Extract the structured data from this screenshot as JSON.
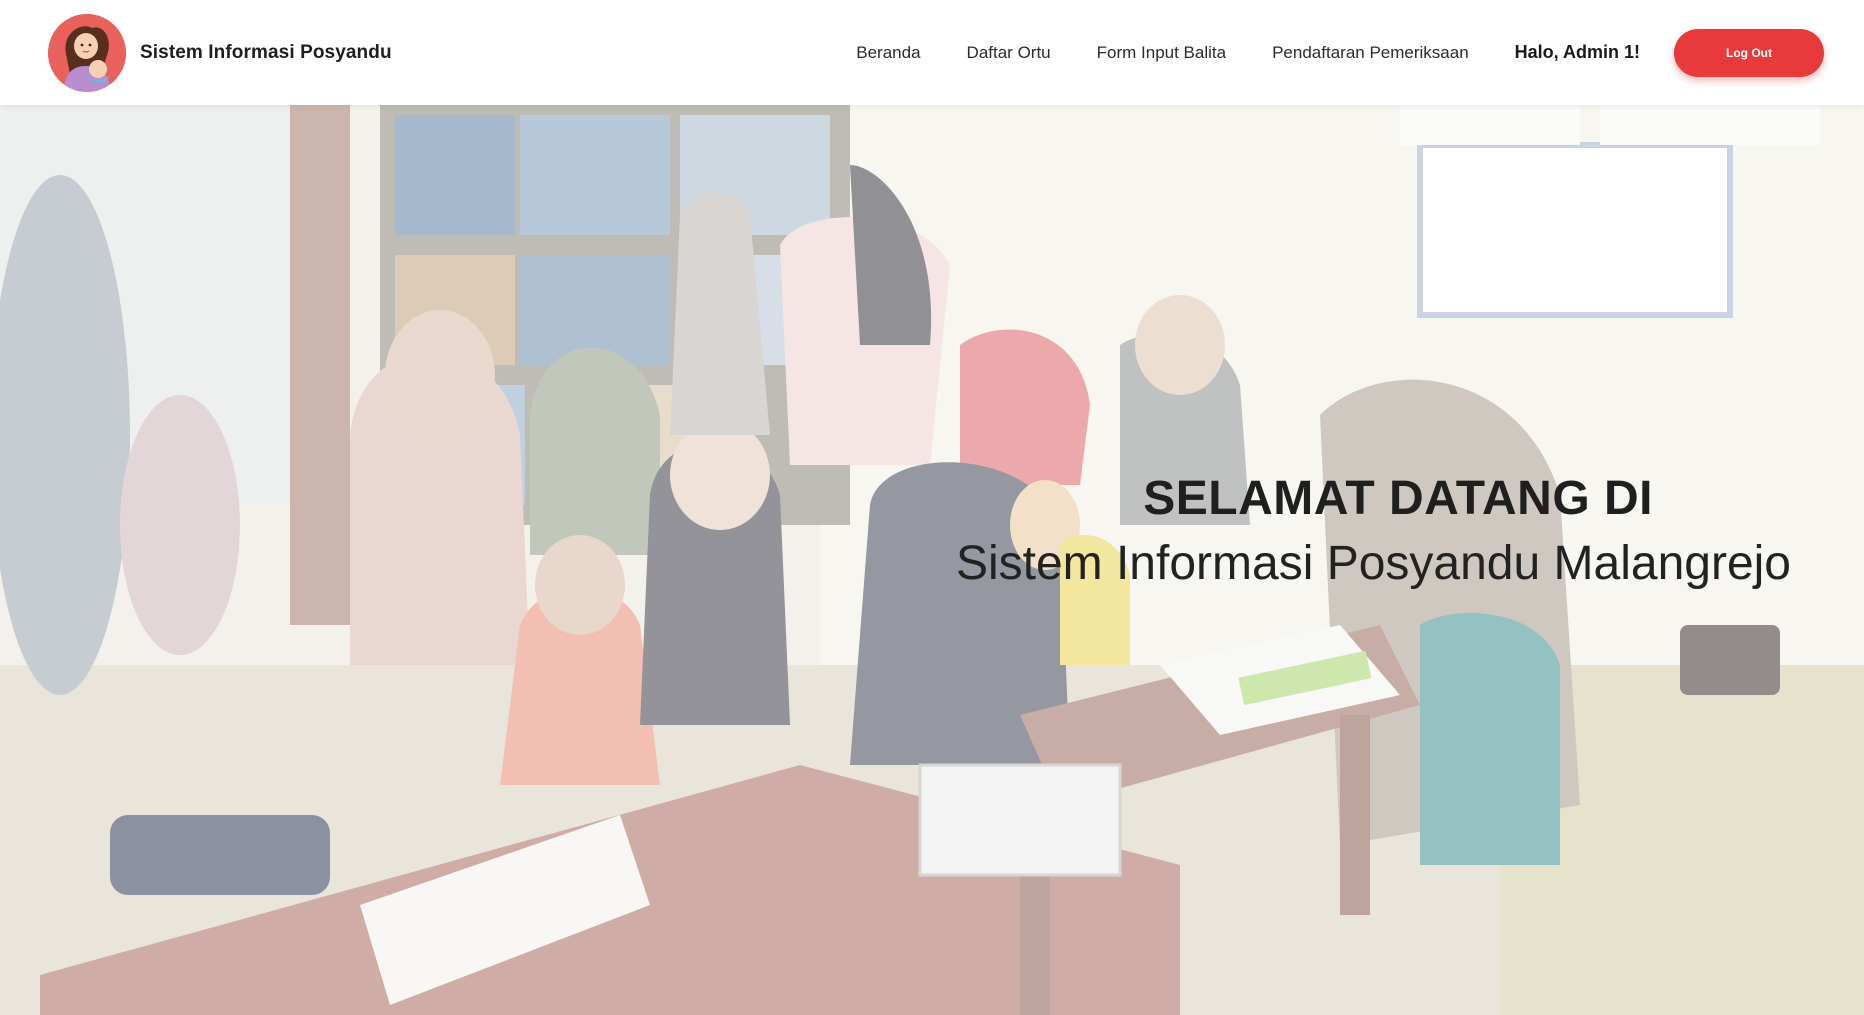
{
  "navbar": {
    "brand_name": "Sistem Informasi Posyandu",
    "logo_icon": "mother-baby-logo",
    "links": [
      {
        "label": "Beranda"
      },
      {
        "label": "Daftar Ortu"
      },
      {
        "label": "Form Input Balita"
      },
      {
        "label": "Pendaftaran Pemeriksaan"
      }
    ],
    "greeting": "Halo, Admin 1!",
    "logout_label": "Log Out"
  },
  "hero": {
    "title": "SELAMAT DATANG DI",
    "subtitle": "Sistem Informasi Posyandu Malangrejo",
    "background_image": "posyandu-activity-photo"
  },
  "colors": {
    "accent": "#e8393b",
    "logo_bg": "#e8625b",
    "text": "#1f1f1f"
  }
}
